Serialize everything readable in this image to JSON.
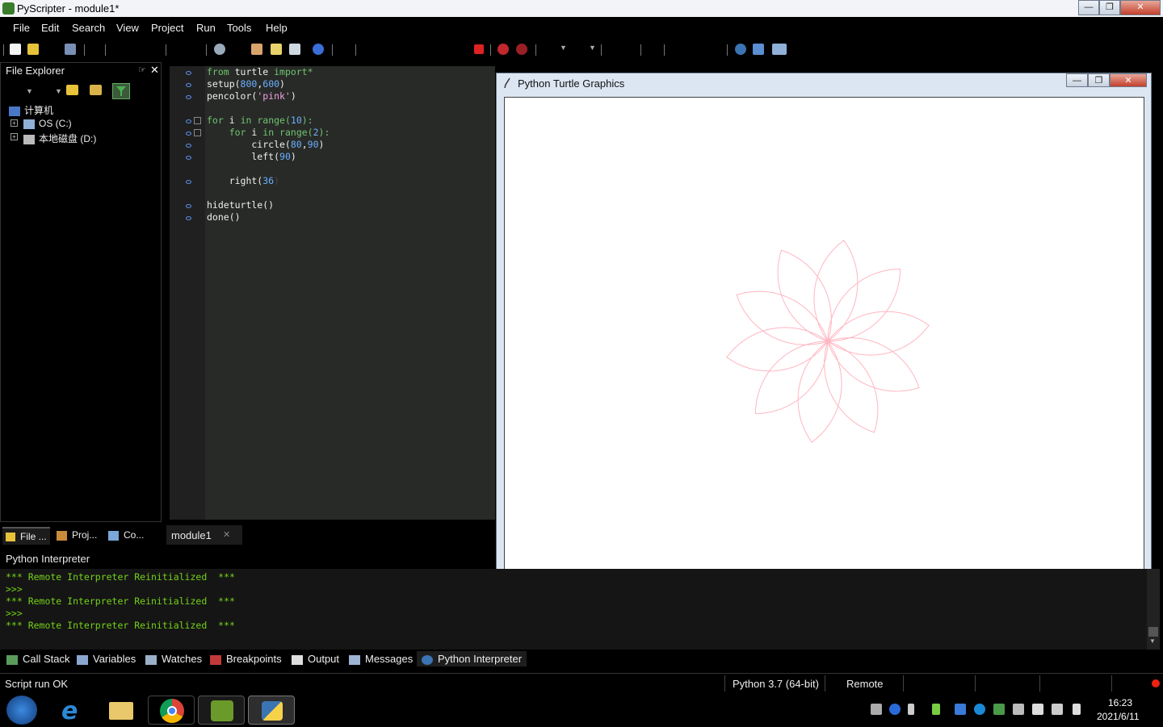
{
  "window": {
    "title": "PyScripter - module1*"
  },
  "menu": [
    "File",
    "Edit",
    "Search",
    "View",
    "Project",
    "Run",
    "Tools",
    "Help"
  ],
  "explorer": {
    "title": "File Explorer",
    "root": "计算机",
    "drives": [
      "OS (C:)",
      "本地磁盘 (D:)"
    ]
  },
  "left_tabs": [
    "File ...",
    "Proj...",
    "Co..."
  ],
  "editor": {
    "tab": "module1",
    "lines": [
      [
        "from",
        " turtle ",
        "import*"
      ],
      [
        "setup(",
        "800",
        ",",
        "600",
        ")"
      ],
      [
        "pencolor(",
        "'pink'",
        ")"
      ],
      [
        "for",
        " i ",
        "in",
        " range(",
        "10",
        "):"
      ],
      [
        "    ",
        "for",
        " i ",
        "in",
        " range(",
        "2",
        "):"
      ],
      [
        "        circle(",
        "80",
        ",",
        "90",
        ")"
      ],
      [
        "        left(",
        "90",
        ")"
      ],
      [
        "    right(",
        "36",
        ")"
      ],
      [
        "hideturtle()"
      ],
      [
        "done()"
      ]
    ]
  },
  "turtle": {
    "title": "Python Turtle Graphics",
    "pen_color": "#ffb6c1",
    "petals": 10,
    "rotation_deg": 36
  },
  "interpreter": {
    "title": "Python Interpreter",
    "lines": [
      "*** Remote Interpreter Reinitialized  ***",
      ">>>",
      "*** Remote Interpreter Reinitialized  ***",
      ">>>",
      "*** Remote Interpreter Reinitialized  ***"
    ]
  },
  "bottom_tabs": [
    "Call Stack",
    "Variables",
    "Watches",
    "Breakpoints",
    "Output",
    "Messages",
    "Python Interpreter"
  ],
  "status": {
    "message": "Script run OK",
    "python": "Python 3.7 (64-bit)",
    "mode": "Remote"
  },
  "clock": {
    "time": "16:23",
    "date": "2021/6/11"
  }
}
